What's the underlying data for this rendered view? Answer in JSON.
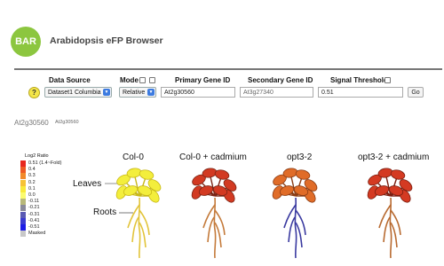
{
  "header": {
    "logo_text": "BAR",
    "app_title": "Arabidopsis eFP Browser"
  },
  "controls": {
    "data_source_label": "Data Source",
    "mode_label": "Mode",
    "primary_gene_label": "Primary Gene ID",
    "secondary_gene_label": "Secondary Gene ID",
    "signal_threshold_label": "Signal Threshold",
    "help_icon_text": "?",
    "data_source_value": "Dataset1 Columbia",
    "mode_value": "Relative",
    "primary_gene_value": "At2g30560",
    "secondary_gene_placeholder": "At3g27340",
    "signal_threshold_value": "0.51",
    "go_label": "Go"
  },
  "gene_heading": {
    "main": "At2g30560",
    "sub": "At2g30560"
  },
  "legend": {
    "title_line1": "Log2 Ratio",
    "entries": [
      {
        "label": "0.51  (1.4~Fold)",
        "color": "#e8271e"
      },
      {
        "label": "0.4",
        "color": "#ee5a24"
      },
      {
        "label": "0.3",
        "color": "#f28a2a"
      },
      {
        "label": "0.2",
        "color": "#f6c236"
      },
      {
        "label": "0.1",
        "color": "#f8e93a"
      },
      {
        "label": "0.0",
        "color": "#fbfb6e"
      },
      {
        "label": "-0.11",
        "color": "#b8b87a"
      },
      {
        "label": "-0.21",
        "color": "#8a8a9a"
      },
      {
        "label": "-0.31",
        "color": "#5a5ab4"
      },
      {
        "label": "-0.41",
        "color": "#3a3ad0"
      },
      {
        "label": "-0.51",
        "color": "#1c1ce6"
      },
      {
        "label": "Masked",
        "color": "#c8c8c8"
      }
    ]
  },
  "plants": [
    {
      "label": "Col-0",
      "leaf_color": "#f3ee3c",
      "leaf_dark": "#c8b818",
      "root_color": "#e2c43a"
    },
    {
      "label": "Col-0 + cadmium",
      "leaf_color": "#d23a22",
      "leaf_dark": "#7a2414",
      "root_color": "#c47a3a"
    },
    {
      "label": "opt3-2",
      "leaf_color": "#e06c28",
      "leaf_dark": "#8a3c14",
      "root_color": "#3a3aa0"
    },
    {
      "label": "opt3-2 + cadmium",
      "leaf_color": "#d43a22",
      "leaf_dark": "#7a1e10",
      "root_color": "#b86a30"
    }
  ],
  "tissues": {
    "leaves": "Leaves",
    "roots": "Roots"
  }
}
